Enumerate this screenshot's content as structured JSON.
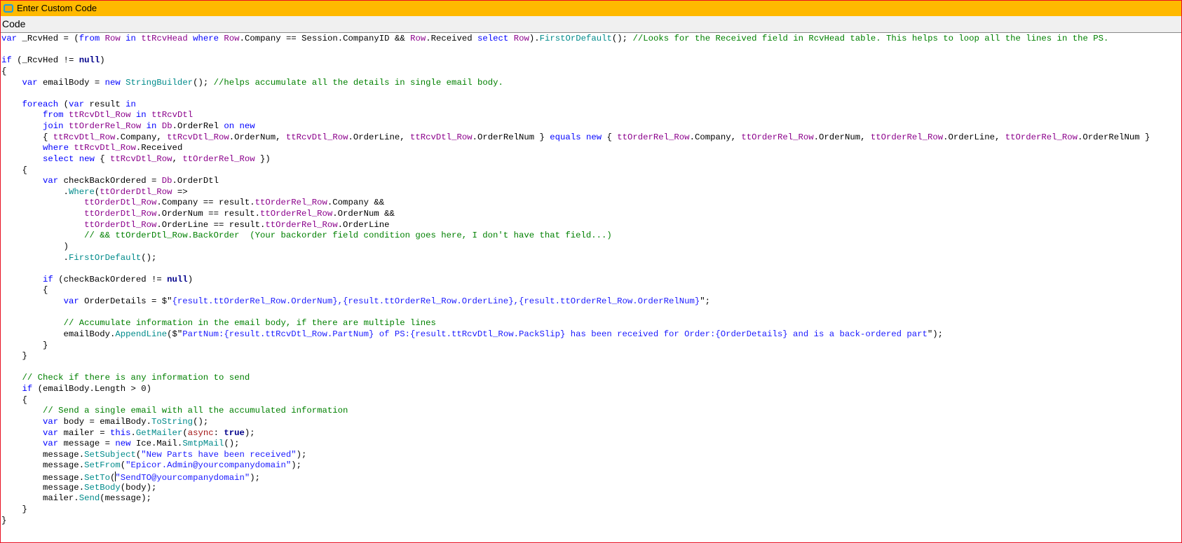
{
  "window": {
    "title": "Enter Custom Code",
    "icon": "app-window-icon",
    "accent_color": "#ffb900",
    "border_color": "#e81123"
  },
  "toolbar": {
    "label": "Code"
  },
  "code": {
    "caret": {
      "line": 41,
      "after_token": 2,
      "offset": 7
    },
    "lines": [
      [
        [
          "k",
          "var"
        ],
        [
          "p",
          " _RcvHed = ("
        ],
        [
          "k",
          "from"
        ],
        [
          "p",
          " "
        ],
        [
          "i",
          "Row"
        ],
        [
          "p",
          " "
        ],
        [
          "k",
          "in"
        ],
        [
          "p",
          " "
        ],
        [
          "i",
          "ttRcvHead"
        ],
        [
          "p",
          " "
        ],
        [
          "k",
          "where"
        ],
        [
          "p",
          " "
        ],
        [
          "i",
          "Row"
        ],
        [
          "p",
          ".Company == Session.CompanyID && "
        ],
        [
          "i",
          "Row"
        ],
        [
          "p",
          ".Received "
        ],
        [
          "k",
          "select"
        ],
        [
          "p",
          " "
        ],
        [
          "i",
          "Row"
        ],
        [
          "p",
          ")."
        ],
        [
          "m",
          "FirstOrDefault"
        ],
        [
          "p",
          "(); "
        ],
        [
          "c",
          "//Looks for the Received field in RcvHead table. This helps to loop all the lines in the PS."
        ]
      ],
      [],
      [
        [
          "k",
          "if"
        ],
        [
          "p",
          " (_RcvHed != "
        ],
        [
          "b",
          "null"
        ],
        [
          "p",
          ")"
        ]
      ],
      [
        [
          "p",
          "{"
        ]
      ],
      [
        [
          "p",
          "    "
        ],
        [
          "k",
          "var"
        ],
        [
          "p",
          " emailBody = "
        ],
        [
          "k",
          "new"
        ],
        [
          "p",
          " "
        ],
        [
          "m",
          "StringBuilder"
        ],
        [
          "p",
          "(); "
        ],
        [
          "c",
          "//helps accumulate all the details in single email body."
        ]
      ],
      [],
      [
        [
          "p",
          "    "
        ],
        [
          "k",
          "foreach"
        ],
        [
          "p",
          " ("
        ],
        [
          "k",
          "var"
        ],
        [
          "p",
          " result "
        ],
        [
          "k",
          "in"
        ]
      ],
      [
        [
          "p",
          "        "
        ],
        [
          "k",
          "from"
        ],
        [
          "p",
          " "
        ],
        [
          "i",
          "ttRcvDtl_Row"
        ],
        [
          "p",
          " "
        ],
        [
          "k",
          "in"
        ],
        [
          "p",
          " "
        ],
        [
          "i",
          "ttRcvDtl"
        ]
      ],
      [
        [
          "p",
          "        "
        ],
        [
          "k",
          "join"
        ],
        [
          "p",
          " "
        ],
        [
          "i",
          "ttOrderRel_Row"
        ],
        [
          "p",
          " "
        ],
        [
          "k",
          "in"
        ],
        [
          "p",
          " "
        ],
        [
          "i",
          "Db"
        ],
        [
          "p",
          ".OrderRel "
        ],
        [
          "k",
          "on"
        ],
        [
          "p",
          " "
        ],
        [
          "k",
          "new"
        ]
      ],
      [
        [
          "p",
          "        { "
        ],
        [
          "i",
          "ttRcvDtl_Row"
        ],
        [
          "p",
          ".Company, "
        ],
        [
          "i",
          "ttRcvDtl_Row"
        ],
        [
          "p",
          ".OrderNum, "
        ],
        [
          "i",
          "ttRcvDtl_Row"
        ],
        [
          "p",
          ".OrderLine, "
        ],
        [
          "i",
          "ttRcvDtl_Row"
        ],
        [
          "p",
          ".OrderRelNum } "
        ],
        [
          "k",
          "equals"
        ],
        [
          "p",
          " "
        ],
        [
          "k",
          "new"
        ],
        [
          "p",
          " { "
        ],
        [
          "i",
          "ttOrderRel_Row"
        ],
        [
          "p",
          ".Company, "
        ],
        [
          "i",
          "ttOrderRel_Row"
        ],
        [
          "p",
          ".OrderNum, "
        ],
        [
          "i",
          "ttOrderRel_Row"
        ],
        [
          "p",
          ".OrderLine, "
        ],
        [
          "i",
          "ttOrderRel_Row"
        ],
        [
          "p",
          ".OrderRelNum }"
        ]
      ],
      [
        [
          "p",
          "        "
        ],
        [
          "k",
          "where"
        ],
        [
          "p",
          " "
        ],
        [
          "i",
          "ttRcvDtl_Row"
        ],
        [
          "p",
          ".Received"
        ]
      ],
      [
        [
          "p",
          "        "
        ],
        [
          "k",
          "select"
        ],
        [
          "p",
          " "
        ],
        [
          "k",
          "new"
        ],
        [
          "p",
          " { "
        ],
        [
          "i",
          "ttRcvDtl_Row"
        ],
        [
          "p",
          ", "
        ],
        [
          "i",
          "ttOrderRel_Row"
        ],
        [
          "p",
          " })"
        ]
      ],
      [
        [
          "p",
          "    {"
        ]
      ],
      [
        [
          "p",
          "        "
        ],
        [
          "k",
          "var"
        ],
        [
          "p",
          " checkBackOrdered = "
        ],
        [
          "i",
          "Db"
        ],
        [
          "p",
          ".OrderDtl"
        ]
      ],
      [
        [
          "p",
          "            ."
        ],
        [
          "m",
          "Where"
        ],
        [
          "p",
          "("
        ],
        [
          "i",
          "ttOrderDtl_Row"
        ],
        [
          "p",
          " =>"
        ]
      ],
      [
        [
          "p",
          "                "
        ],
        [
          "i",
          "ttOrderDtl_Row"
        ],
        [
          "p",
          ".Company == result."
        ],
        [
          "i",
          "ttOrderRel_Row"
        ],
        [
          "p",
          ".Company &&"
        ]
      ],
      [
        [
          "p",
          "                "
        ],
        [
          "i",
          "ttOrderDtl_Row"
        ],
        [
          "p",
          ".OrderNum == result."
        ],
        [
          "i",
          "ttOrderRel_Row"
        ],
        [
          "p",
          ".OrderNum &&"
        ]
      ],
      [
        [
          "p",
          "                "
        ],
        [
          "i",
          "ttOrderDtl_Row"
        ],
        [
          "p",
          ".OrderLine == result."
        ],
        [
          "i",
          "ttOrderRel_Row"
        ],
        [
          "p",
          ".OrderLine"
        ]
      ],
      [
        [
          "p",
          "                "
        ],
        [
          "c",
          "// && ttOrderDtl_Row.BackOrder  (Your backorder field condition goes here, I don't have that field...)"
        ]
      ],
      [
        [
          "p",
          "            )"
        ]
      ],
      [
        [
          "p",
          "            ."
        ],
        [
          "m",
          "FirstOrDefault"
        ],
        [
          "p",
          "();"
        ]
      ],
      [],
      [
        [
          "p",
          "        "
        ],
        [
          "k",
          "if"
        ],
        [
          "p",
          " (checkBackOrdered != "
        ],
        [
          "b",
          "null"
        ],
        [
          "p",
          ")"
        ]
      ],
      [
        [
          "p",
          "        {"
        ]
      ],
      [
        [
          "p",
          "            "
        ],
        [
          "k",
          "var"
        ],
        [
          "p",
          " OrderDetails = $\""
        ],
        [
          "s",
          "{result.ttOrderRel_Row.OrderNum},{result.ttOrderRel_Row.OrderLine},{result.ttOrderRel_Row.OrderRelNum}"
        ],
        [
          "p",
          "\";"
        ]
      ],
      [],
      [
        [
          "p",
          "            "
        ],
        [
          "c",
          "// Accumulate information in the email body, if there are multiple lines"
        ]
      ],
      [
        [
          "p",
          "            emailBody."
        ],
        [
          "m",
          "AppendLine"
        ],
        [
          "p",
          "($\""
        ],
        [
          "s",
          "PartNum:{result.ttRcvDtl_Row.PartNum} of PS:{result.ttRcvDtl_Row.PackSlip} has been received for Order:{OrderDetails} and is a back-ordered part"
        ],
        [
          "p",
          "\");"
        ]
      ],
      [
        [
          "p",
          "        }"
        ]
      ],
      [
        [
          "p",
          "    }"
        ]
      ],
      [],
      [
        [
          "p",
          "    "
        ],
        [
          "c",
          "// Check if there is any information to send"
        ]
      ],
      [
        [
          "p",
          "    "
        ],
        [
          "k",
          "if"
        ],
        [
          "p",
          " (emailBody.Length > 0)"
        ]
      ],
      [
        [
          "p",
          "    {"
        ]
      ],
      [
        [
          "p",
          "        "
        ],
        [
          "c",
          "// Send a single email with all the accumulated information"
        ]
      ],
      [
        [
          "p",
          "        "
        ],
        [
          "k",
          "var"
        ],
        [
          "p",
          " body = emailBody."
        ],
        [
          "m",
          "ToString"
        ],
        [
          "p",
          "();"
        ]
      ],
      [
        [
          "p",
          "        "
        ],
        [
          "k",
          "var"
        ],
        [
          "p",
          " mailer = "
        ],
        [
          "k",
          "this"
        ],
        [
          "p",
          "."
        ],
        [
          "m",
          "GetMailer"
        ],
        [
          "p",
          "("
        ],
        [
          "a",
          "async"
        ],
        [
          "p",
          ": "
        ],
        [
          "b",
          "true"
        ],
        [
          "p",
          ");"
        ]
      ],
      [
        [
          "p",
          "        "
        ],
        [
          "k",
          "var"
        ],
        [
          "p",
          " message = "
        ],
        [
          "k",
          "new"
        ],
        [
          "p",
          " Ice.Mail."
        ],
        [
          "m",
          "SmtpMail"
        ],
        [
          "p",
          "();"
        ]
      ],
      [
        [
          "p",
          "        message."
        ],
        [
          "m",
          "SetSubject"
        ],
        [
          "p",
          "("
        ],
        [
          "s",
          "\"New Parts have been received\""
        ],
        [
          "p",
          ");"
        ]
      ],
      [
        [
          "p",
          "        message."
        ],
        [
          "m",
          "SetFrom"
        ],
        [
          "p",
          "("
        ],
        [
          "s",
          "\"Epicor.Admin@yourcompanydomain\""
        ],
        [
          "p",
          ");"
        ]
      ],
      [
        [
          "p",
          "        message."
        ],
        [
          "m",
          "SetTo"
        ],
        [
          "p",
          "("
        ],
        [
          "s",
          "\"SendTO"
        ],
        [
          "s",
          "@yourcompanydomain\""
        ],
        [
          "p",
          ");"
        ]
      ],
      [
        [
          "p",
          "        message."
        ],
        [
          "m",
          "SetBody"
        ],
        [
          "p",
          "(body);"
        ]
      ],
      [
        [
          "p",
          "        mailer."
        ],
        [
          "m",
          "Send"
        ],
        [
          "p",
          "(message);"
        ]
      ],
      [
        [
          "p",
          "    }"
        ]
      ],
      [
        [
          "p",
          "}"
        ]
      ]
    ]
  }
}
